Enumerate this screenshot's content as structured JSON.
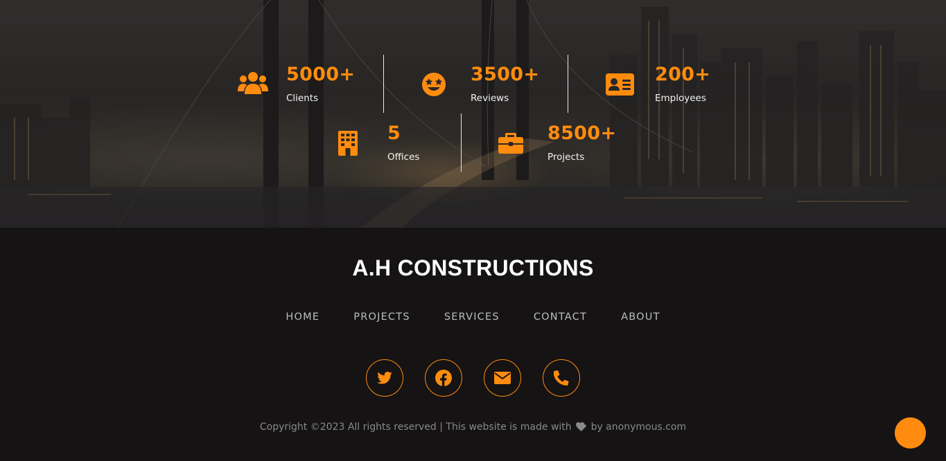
{
  "stats": [
    {
      "value": "5000+",
      "label": "Clients",
      "icon": "users-icon"
    },
    {
      "value": "3500+",
      "label": "Reviews",
      "icon": "star-eyes-face-icon"
    },
    {
      "value": "200+",
      "label": "Employees",
      "icon": "id-card-icon"
    },
    {
      "value": "5",
      "label": "Offices",
      "icon": "building-icon"
    },
    {
      "value": "8500+",
      "label": "Projects",
      "icon": "briefcase-icon"
    }
  ],
  "footer": {
    "brand": "A.H CONSTRUCTIONS",
    "nav": [
      "HOME",
      "PROJECTS",
      "SERVICES",
      "CONTACT",
      "ABOUT"
    ],
    "socials": [
      "twitter-icon",
      "facebook-icon",
      "envelope-icon",
      "phone-icon"
    ],
    "copyright_prefix": "Copyright ©2023 All rights reserved | This website is made with",
    "copyright_suffix": "by anonymous.com"
  },
  "colors": {
    "accent": "#ff8c0f",
    "background": "#151314",
    "text_light": "#f2f2f2",
    "text_muted": "#8a8a8a"
  }
}
